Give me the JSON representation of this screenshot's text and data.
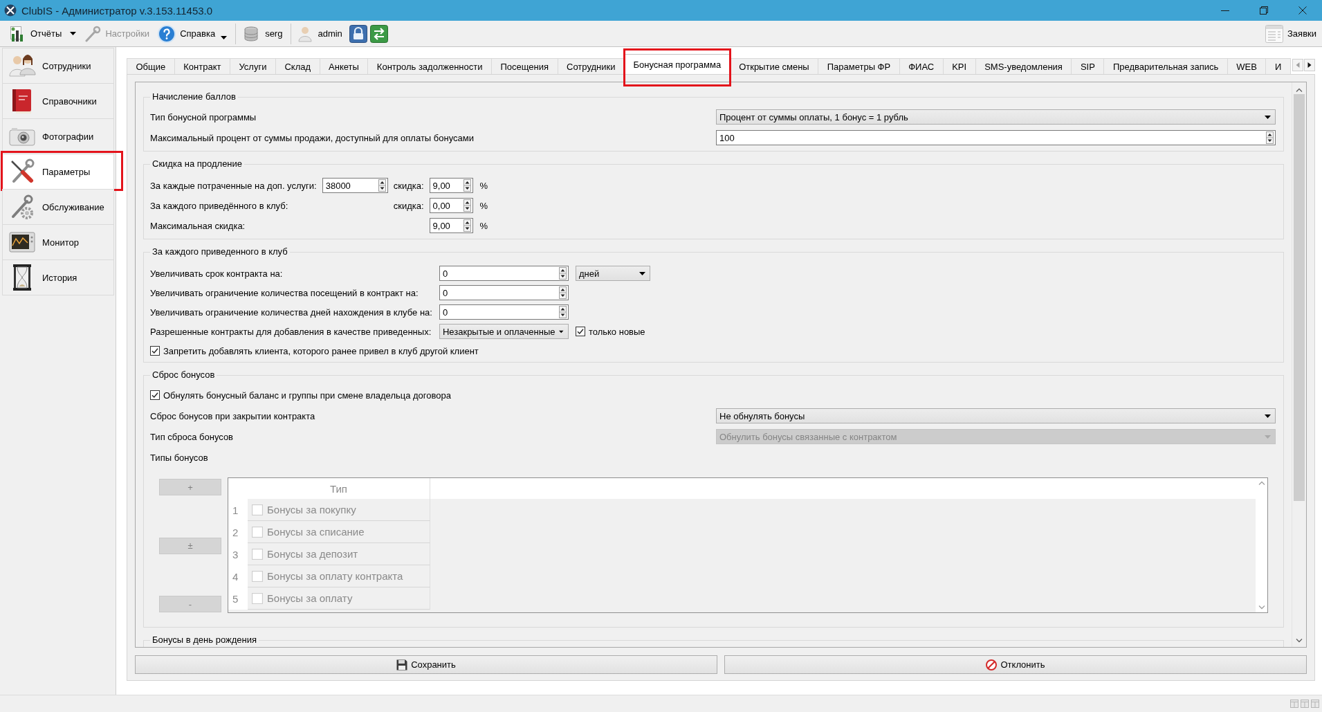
{
  "window": {
    "title": "ClubIS - Администратор v.3.153.11453.0"
  },
  "toolbar": {
    "reports": {
      "label": "Отчёты"
    },
    "settings": {
      "label": "Настройки",
      "disabled": true
    },
    "help": {
      "label": "Справка"
    },
    "database_user": {
      "label": "serg"
    },
    "user": {
      "label": "admin"
    },
    "requests": {
      "label": "Заявки"
    }
  },
  "sidebar": {
    "items": [
      {
        "label": "Сотрудники",
        "selected": false,
        "highlighted": false
      },
      {
        "label": "Справочники",
        "selected": false,
        "highlighted": false
      },
      {
        "label": "Фотографии",
        "selected": false,
        "highlighted": false
      },
      {
        "label": "Параметры",
        "selected": true,
        "highlighted": true
      },
      {
        "label": "Обслуживание",
        "selected": false,
        "highlighted": false
      },
      {
        "label": "Монитор",
        "selected": false,
        "highlighted": false
      },
      {
        "label": "История",
        "selected": false,
        "highlighted": false
      }
    ]
  },
  "tabs": [
    {
      "label": "Общие",
      "selected": false,
      "highlighted": false
    },
    {
      "label": "Контракт",
      "selected": false,
      "highlighted": false
    },
    {
      "label": "Услуги",
      "selected": false,
      "highlighted": false
    },
    {
      "label": "Склад",
      "selected": false,
      "highlighted": false
    },
    {
      "label": "Анкеты",
      "selected": false,
      "highlighted": false
    },
    {
      "label": "Контроль задолженности",
      "selected": false,
      "highlighted": false
    },
    {
      "label": "Посещения",
      "selected": false,
      "highlighted": false
    },
    {
      "label": "Сотрудники",
      "selected": false,
      "highlighted": false
    },
    {
      "label": "Бонусная программа",
      "selected": true,
      "highlighted": true
    },
    {
      "label": "Открытие смены",
      "selected": false,
      "highlighted": false
    },
    {
      "label": "Параметры ФР",
      "selected": false,
      "highlighted": false
    },
    {
      "label": "ФИАС",
      "selected": false,
      "highlighted": false
    },
    {
      "label": "KPI",
      "selected": false,
      "highlighted": false
    },
    {
      "label": "SMS-уведомления",
      "selected": false,
      "highlighted": false
    },
    {
      "label": "SIP",
      "selected": false,
      "highlighted": false
    },
    {
      "label": "Предварительная запись",
      "selected": false,
      "highlighted": false
    },
    {
      "label": "WEB",
      "selected": false,
      "highlighted": false
    },
    {
      "label": "И",
      "selected": false,
      "highlighted": false
    }
  ],
  "bonus_accrual": {
    "title": "Начисление баллов",
    "program_type": {
      "label": "Тип бонусной программы",
      "value": "Процент от суммы оплаты, 1 бонус = 1 рубль"
    },
    "max_percent": {
      "label": "Максимальный процент от суммы продажи, доступный для оплаты бонусами",
      "value": "100"
    }
  },
  "renewal_discount": {
    "title": "Скидка на продление",
    "rows": [
      {
        "label": "За каждые потраченные на доп. услуги:",
        "amount": "38000",
        "discount_label": "скидка:",
        "discount": "9,00",
        "unit": "%"
      },
      {
        "label": "За каждого приведённого в клуб:",
        "discount_label": "скидка:",
        "discount": "0,00",
        "unit": "%"
      },
      {
        "label": "Максимальная скидка:",
        "discount": "9,00",
        "unit": "%"
      }
    ]
  },
  "referral": {
    "title": "За каждого приведенного в клуб",
    "contract_extension": {
      "label": "Увеличивать срок контракта на:",
      "value": "0",
      "unit": "дней"
    },
    "visits_limit": {
      "label": "Увеличивать ограничение количества посещений в контракт на:",
      "value": "0"
    },
    "days_limit": {
      "label": "Увеличивать ограничение количества дней нахождения в клубе на:",
      "value": "0"
    },
    "allowed_contracts": {
      "label": "Разрешенные контракты для добавления в качестве приведенных:",
      "value": "Незакрытые и оплаченные",
      "only_new": {
        "label": "только новые",
        "checked": true
      }
    },
    "forbid_rereferral": {
      "label": "Запретить добавлять клиента, которого ранее привел в клуб другой клиент",
      "checked": true
    }
  },
  "bonus_reset": {
    "title": "Сброс бонусов",
    "reset_on_owner_change": {
      "label": "Обнулять бонусный баланс и группы при смене владельца договора",
      "checked": true
    },
    "reset_on_close": {
      "label": "Сброс бонусов при закрытии контракта",
      "value": "Не обнулять бонусы"
    },
    "reset_type": {
      "label": "Тип сброса бонусов",
      "value": "Обнулить бонусы связанные с контрактом",
      "disabled": true
    },
    "bonus_types": {
      "label": "Типы бонусов",
      "disabled": true,
      "buttons": [
        "+",
        "±",
        "-"
      ],
      "columns": [
        "Тип"
      ],
      "rows": [
        {
          "number": "1",
          "name": "Бонусы за покупку",
          "checked": false
        },
        {
          "number": "2",
          "name": "Бонусы за списание",
          "checked": false
        },
        {
          "number": "3",
          "name": "Бонусы за депозит",
          "checked": false
        },
        {
          "number": "4",
          "name": "Бонусы за оплату контракта",
          "checked": false
        },
        {
          "number": "5",
          "name": "Бонусы за оплату",
          "checked": false
        }
      ]
    }
  },
  "birthday_bonuses": {
    "title": "Бонусы в день рождения"
  },
  "save_button": {
    "label": "Сохранить"
  },
  "cancel_button": {
    "label": "Отклонить"
  }
}
